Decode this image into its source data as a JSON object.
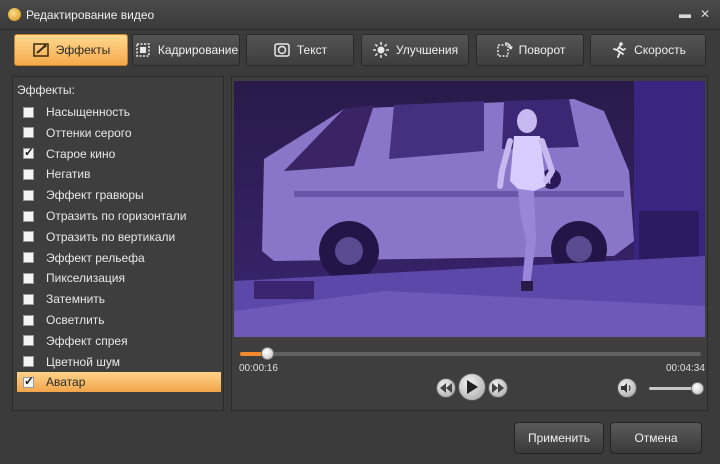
{
  "window": {
    "title": "Редактирование видео"
  },
  "tabs": [
    {
      "label": "Эффекты",
      "icon": "effects-icon",
      "active": true
    },
    {
      "label": "Кадрирование",
      "icon": "crop-icon",
      "active": false
    },
    {
      "label": "Текст",
      "icon": "text-icon",
      "active": false
    },
    {
      "label": "Улучшения",
      "icon": "brightness-icon",
      "active": false
    },
    {
      "label": "Поворот",
      "icon": "rotate-icon",
      "active": false
    },
    {
      "label": "Скорость",
      "icon": "running-person-icon",
      "active": false
    }
  ],
  "effects": {
    "title": "Эффекты:",
    "items": [
      {
        "label": "Насыщенность",
        "checked": false,
        "selected": false
      },
      {
        "label": "Оттенки серого",
        "checked": false,
        "selected": false
      },
      {
        "label": "Старое кино",
        "checked": true,
        "selected": false
      },
      {
        "label": "Негатив",
        "checked": false,
        "selected": false
      },
      {
        "label": "Эффект гравюры",
        "checked": false,
        "selected": false
      },
      {
        "label": "Отразить по горизонтали",
        "checked": false,
        "selected": false
      },
      {
        "label": "Отразить по вертикали",
        "checked": false,
        "selected": false
      },
      {
        "label": "Эффект рельефа",
        "checked": false,
        "selected": false
      },
      {
        "label": "Пикселизация",
        "checked": false,
        "selected": false
      },
      {
        "label": "Затемнить",
        "checked": false,
        "selected": false
      },
      {
        "label": "Осветлить",
        "checked": false,
        "selected": false
      },
      {
        "label": "Эффект спрея",
        "checked": false,
        "selected": false
      },
      {
        "label": "Цветной шум",
        "checked": false,
        "selected": false
      },
      {
        "label": "Аватар",
        "checked": true,
        "selected": true
      }
    ]
  },
  "player": {
    "current_time": "00:00:16",
    "total_time": "00:04:34",
    "progress": 0.058,
    "volume": 1.0
  },
  "buttons": {
    "apply": "Применить",
    "cancel": "Отмена"
  },
  "colors": {
    "accent": "#f5a94a",
    "video_tint": "#5a2fa0"
  }
}
